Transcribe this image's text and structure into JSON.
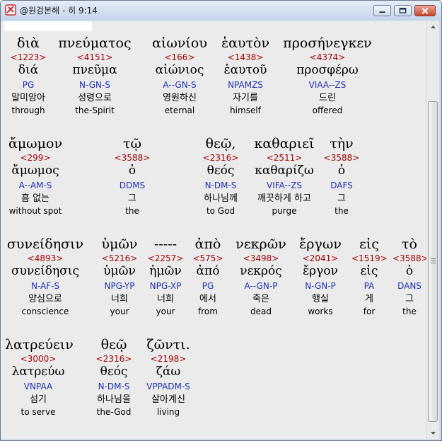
{
  "window": {
    "title": "@원겅본해 - 히 9:14"
  },
  "colors": {
    "strong_number": "#a00000",
    "parsing": "#1f32b0",
    "background": "#ebebeb"
  },
  "rows": [
    {
      "tokens": [
        {
          "greek": "διὰ",
          "strong": "<1223>",
          "lemma": "διά",
          "parse": "PG",
          "korean": "말미암아",
          "english": "through"
        },
        {
          "greek": "πνεύματος",
          "strong": "<4151>",
          "lemma": "πνεῦμα",
          "parse": "N-GN-S",
          "korean": "성령으로",
          "english": "the-Spirit"
        },
        {
          "greek": "αἰωνίου",
          "strong": "<166>",
          "lemma": "αἰώνιος",
          "parse": "A--GN-S",
          "korean": "영원하신",
          "english": "eternal"
        },
        {
          "greek": "ἑαυτὸν",
          "strong": "<1438>",
          "lemma": "ἑαυτοῦ",
          "parse": "NPAMZS",
          "korean": "자기를",
          "english": "himself"
        },
        {
          "greek": "προσήνεγκεν",
          "strong": "<4374>",
          "lemma": "προσφέρω",
          "parse": "VIAA--ZS",
          "korean": "드린",
          "english": "offered"
        }
      ]
    },
    {
      "tokens": [
        {
          "greek": "ἄμωμον",
          "strong": "<299>",
          "lemma": "ἄμωμος",
          "parse": "A--AM-S",
          "korean": "흠 없는",
          "english": "without spot"
        },
        {
          "greek": "τῷ",
          "strong": "<3588>",
          "lemma": "ὁ",
          "parse": "DDMS",
          "korean": "그",
          "english": "the"
        },
        {
          "greek": "θεῷ,",
          "strong": "<2316>",
          "lemma": "θεός",
          "parse": "N-DM-S",
          "korean": "하나님께",
          "english": "to God"
        },
        {
          "greek": "καθαριεῖ",
          "strong": "<2511>",
          "lemma": "καθαρίζω",
          "parse": "VIFA--ZS",
          "korean": "깨끗하게 하고",
          "english": "purge"
        },
        {
          "greek": "τὴν",
          "strong": "<3588>",
          "lemma": "ὁ",
          "parse": "DAFS",
          "korean": "그",
          "english": "the"
        }
      ]
    },
    {
      "tokens": [
        {
          "greek": "συνείδησιν",
          "strong": "<4893>",
          "lemma": "συνείδησις",
          "parse": "N-AF-S",
          "korean": "양심으로",
          "english": "conscience"
        },
        {
          "greek": "ὑμῶν",
          "strong": "<5216>",
          "lemma": "ὑμῶν",
          "parse": "NPG-YP",
          "korean": "너희",
          "english": "your"
        },
        {
          "greek": "-----",
          "strong": "<2257>",
          "lemma": "ἡμῶν",
          "parse": "NPG-XP",
          "korean": "너희",
          "english": "your"
        },
        {
          "greek": "ἀπὸ",
          "strong": "<575>",
          "lemma": "ἀπό",
          "parse": "PG",
          "korean": "에서",
          "english": "from"
        },
        {
          "greek": "νεκρῶν",
          "strong": "<3498>",
          "lemma": "νεκρός",
          "parse": "A--GN-P",
          "korean": "죽은",
          "english": "dead"
        },
        {
          "greek": "ἔργων",
          "strong": "<2041>",
          "lemma": "ἔργον",
          "parse": "N-GN-P",
          "korean": "행실",
          "english": "works"
        },
        {
          "greek": "εἰς",
          "strong": "<1519>",
          "lemma": "εἰς",
          "parse": "PA",
          "korean": "게",
          "english": "for"
        },
        {
          "greek": "τὸ",
          "strong": "<3588>",
          "lemma": "ὁ",
          "parse": "DANS",
          "korean": "그",
          "english": "the"
        }
      ]
    },
    {
      "tokens": [
        {
          "greek": "λατρεύειν",
          "strong": "<3000>",
          "lemma": "λατρεύω",
          "parse": "VNPAA",
          "korean": "섬기",
          "english": "to serve"
        },
        {
          "greek": "θεῷ",
          "strong": "<2316>",
          "lemma": "θεός",
          "parse": "N-DM-S",
          "korean": "하나님을",
          "english": "the-God"
        },
        {
          "greek": "ζῶντι.",
          "strong": "<2198>",
          "lemma": "ζάω",
          "parse": "VPPADM-S",
          "korean": "살아계신",
          "english": "living"
        }
      ]
    }
  ]
}
